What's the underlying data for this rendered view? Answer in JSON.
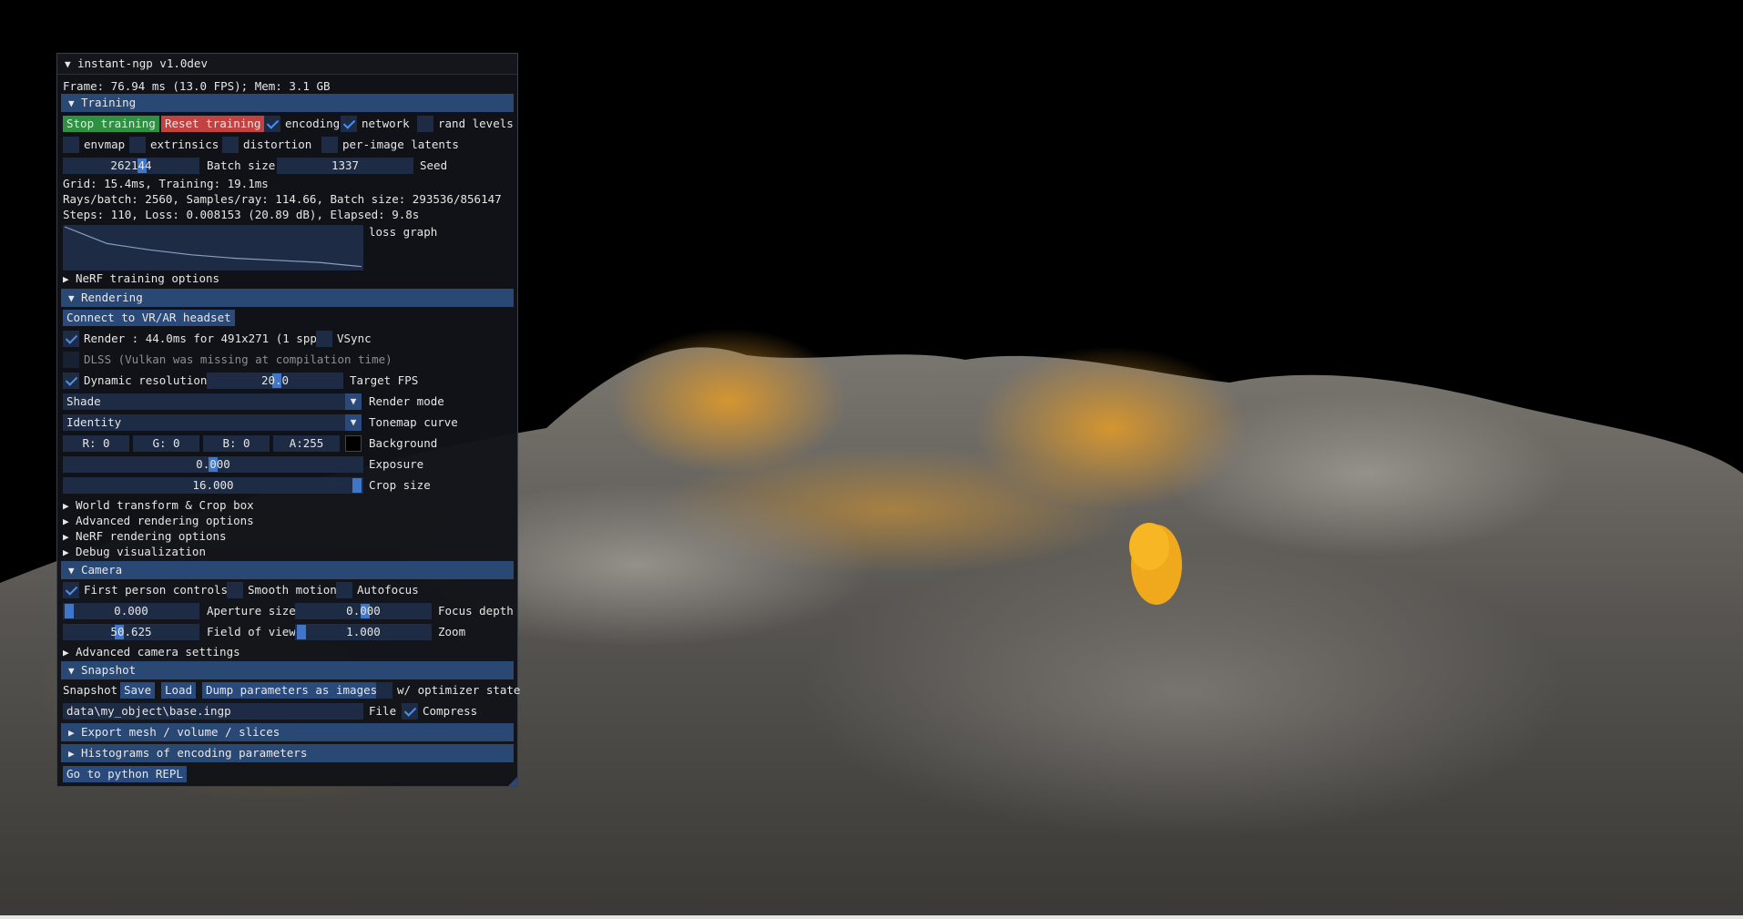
{
  "window": {
    "title": "instant-ngp v1.0dev"
  },
  "stats": {
    "frame": "Frame: 76.94 ms (13.0 FPS); Mem: 3.1 GB"
  },
  "training": {
    "header": "Training",
    "stop_button": "Stop training",
    "reset_button": "Reset training",
    "encoding_label": "encoding",
    "network_label": "network",
    "rand_levels_label": "rand levels",
    "envmap_label": "envmap",
    "extrinsics_label": "extrinsics",
    "distortion_label": "distortion",
    "per_image_latents_label": "per-image latents",
    "batch_size_value": "262144",
    "batch_size_label": "Batch size",
    "seed_value": "1337",
    "seed_label": "Seed",
    "grid_text": "Grid: 15.4ms, Training: 19.1ms",
    "rays_text": "Rays/batch: 2560, Samples/ray: 114.66, Batch size: 293536/856147",
    "steps_text": "Steps: 110, Loss: 0.008153 (20.89 dB), Elapsed: 9.8s",
    "loss_graph_label": "loss graph",
    "nerf_training_options": "NeRF training options",
    "checkboxes": {
      "encoding": true,
      "network": true,
      "rand_levels": false,
      "envmap": false,
      "extrinsics": false,
      "distortion": false,
      "per_image_latents": false
    }
  },
  "rendering": {
    "header": "Rendering",
    "vr_button": "Connect to VR/AR headset",
    "render_label": "Render : 44.0ms for 491x271 (1 spp)",
    "vsync_label": "VSync",
    "dlss_label": "DLSS (Vulkan was missing at compilation time)",
    "dynamic_resolution_label": "Dynamic resolution",
    "target_fps_value": "20.0",
    "target_fps_label": "Target FPS",
    "render_mode_value": "Shade",
    "render_mode_label": "Render mode",
    "tonemap_value": "Identity",
    "tonemap_label": "Tonemap curve",
    "bg_r": "R:  0",
    "bg_g": "G:  0",
    "bg_b": "B:  0",
    "bg_a": "A:255",
    "background_label": "Background",
    "exposure_value": "0.000",
    "exposure_label": "Exposure",
    "crop_value": "16.000",
    "crop_label": "Crop size",
    "world_transform": "World transform & Crop box",
    "advanced_rendering": "Advanced rendering options",
    "nerf_rendering": "NeRF rendering options",
    "debug_visualization": "Debug visualization",
    "checkboxes": {
      "render": true,
      "vsync": false,
      "dlss": false,
      "dynamic_resolution": true
    }
  },
  "camera": {
    "header": "Camera",
    "first_person_label": "First person controls",
    "smooth_motion_label": "Smooth motion",
    "autofocus_label": "Autofocus",
    "aperture_value": "0.000",
    "aperture_label": "Aperture size",
    "focus_depth_value": "0.000",
    "focus_depth_label": "Focus depth",
    "fov_value": "50.625",
    "fov_label": "Field of view",
    "zoom_value": "1.000",
    "zoom_label": "Zoom",
    "advanced_camera": "Advanced camera settings",
    "checkboxes": {
      "first_person": true,
      "smooth_motion": false,
      "autofocus": false
    }
  },
  "snapshot": {
    "header": "Snapshot",
    "label": "Snapshot",
    "save_button": "Save",
    "load_button": "Load",
    "dump_button": "Dump parameters as images",
    "optimizer_state_label": "w/ optimizer state",
    "path_value": "data\\my_object\\base.ingp",
    "file_label": "File",
    "compress_label": "Compress",
    "checkboxes": {
      "optimizer_state": false,
      "compress": true
    }
  },
  "export": {
    "header": "Export mesh / volume / slices"
  },
  "histograms": {
    "header": "Histograms of encoding parameters"
  },
  "repl": {
    "button": "Go to python REPL"
  },
  "colors": {
    "accent": "#2a4874",
    "button_green": "#2e9142",
    "button_red": "#c24141",
    "check": "#4d8ff0"
  },
  "loss_graph": [
    1.0,
    0.6,
    0.45,
    0.33,
    0.25,
    0.2,
    0.15,
    0.05
  ]
}
